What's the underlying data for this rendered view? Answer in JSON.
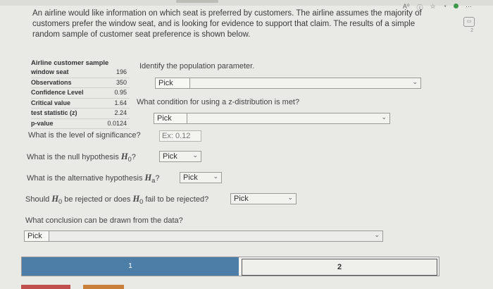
{
  "intro": "An airline would like information on which seat is preferred by customers. The airline assumes the majority of customers prefer the window seat, and is looking for evidence to support that claim. The results of a simple random sample of customer seat preference is shown below.",
  "stats": {
    "title": "Airline customer sample",
    "rows": [
      {
        "label": "window seat",
        "value": "196"
      },
      {
        "label": "Observations",
        "value": "350"
      },
      {
        "label": "Confidence Level",
        "value": "0.95"
      },
      {
        "label": "Critical value",
        "value": "1.64"
      },
      {
        "label": "test statistic (z)",
        "value": "2.24"
      },
      {
        "label": "p-value",
        "value": "0.0124"
      }
    ]
  },
  "questions": {
    "q1": {
      "label": "Identify the population parameter.",
      "select": "Pick"
    },
    "q2": {
      "label": "What condition for using a z-distribution is met?",
      "select": "Pick"
    },
    "q3": {
      "label": "What is the level of significance?",
      "placeholder": "Ex: 0.12"
    },
    "q4": {
      "label_pre": "What is the null hypothesis ",
      "h": "H",
      "sub": "0",
      "label_post": "?",
      "select": "Pick"
    },
    "q5": {
      "label_pre": "What is the alternative hypothesis ",
      "h": "H",
      "sub": "a",
      "label_post": "?",
      "select": "Pick"
    },
    "q6": {
      "label_pre": "Should ",
      "h": "H",
      "sub": "0",
      "label_mid": " be rejected or does ",
      "h2": "H",
      "sub2": "0",
      "label_post": " fail to be rejected?",
      "select": "Pick"
    },
    "q7": {
      "label": "What conclusion can be drawn from the data?",
      "select": "Pick"
    }
  },
  "pager": {
    "page1": "1",
    "page2": "2"
  },
  "side": {
    "num": "2"
  }
}
